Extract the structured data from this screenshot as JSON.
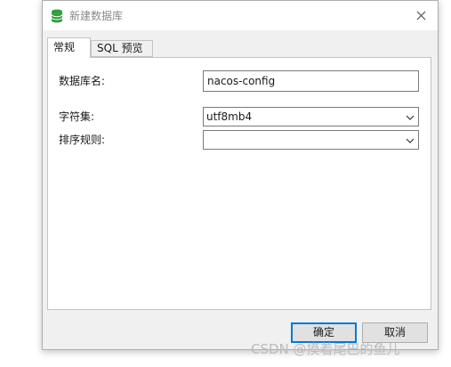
{
  "window": {
    "title": "新建数据库",
    "icon": "database-icon",
    "close_icon": "close-icon"
  },
  "tabs": [
    {
      "label": "常规",
      "active": true
    },
    {
      "label": "SQL 预览",
      "active": false
    }
  ],
  "form": {
    "db_name_label": "数据库名:",
    "db_name_value": "nacos-config",
    "charset_label": "字符集:",
    "charset_value": "utf8mb4",
    "collation_label": "排序规则:",
    "collation_value": ""
  },
  "buttons": {
    "ok_label": "确定",
    "cancel_label": "取消"
  },
  "watermark": "CSDN @摸着尾巴的鱼儿",
  "colors": {
    "icon_green": "#2e9e3e",
    "focus_blue": "#0078d7"
  }
}
